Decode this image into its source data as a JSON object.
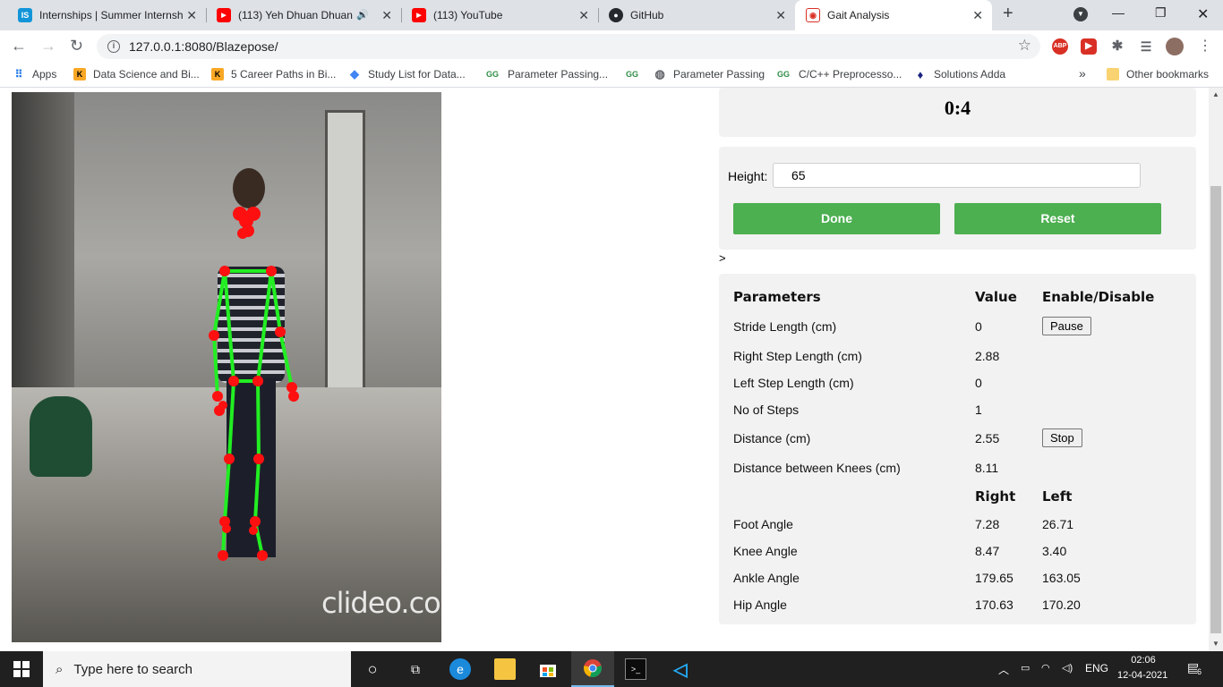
{
  "browser": {
    "tabs": [
      {
        "label": "Internships | Summer Internsh",
        "icon": "internshala-icon",
        "color": "#1295d8",
        "glyph": "IS"
      },
      {
        "label": "(113) Yeh Dhuan Dhuan [",
        "icon": "youtube-icon",
        "color": "#ff0000",
        "glyph": "▶"
      },
      {
        "label": "(113) YouTube",
        "icon": "youtube-icon",
        "color": "#ff0000",
        "glyph": "▶"
      },
      {
        "label": "GitHub",
        "icon": "github-icon",
        "color": "#24292e",
        "glyph": "●"
      },
      {
        "label": "Gait Analysis",
        "icon": "gait-analysis-icon",
        "color": "#d93025",
        "glyph": "◉"
      }
    ],
    "url": "127.0.0.1:8080/Blazepose/",
    "bookmarks": [
      {
        "label": "Apps",
        "icon": "apps-grid-icon"
      },
      {
        "label": "Data Science and Bi...",
        "icon": "k-icon"
      },
      {
        "label": "5 Career Paths in Bi...",
        "icon": "k-icon"
      },
      {
        "label": "Study List for Data...",
        "icon": "diamond-icon"
      },
      {
        "label": "Parameter Passing...",
        "icon": "geeksforgeeks-icon"
      },
      {
        "label": "",
        "icon": "geeksforgeeks-icon"
      },
      {
        "label": "Parameter Passing",
        "icon": "globe-icon"
      },
      {
        "label": "C/C++ Preprocesso...",
        "icon": "geeksforgeeks-icon"
      },
      {
        "label": "Solutions Adda",
        "icon": "solutions-adda-icon"
      }
    ],
    "more_bookmarks": "»",
    "other_bookmarks": "Other bookmarks"
  },
  "page": {
    "timer": "0:4",
    "height_label": "Height:",
    "height_value": "65",
    "done_label": "Done",
    "reset_label": "Reset",
    "gt_text": ">",
    "watermark": "clideo.com",
    "params": {
      "headers": {
        "param": "Parameters",
        "value": "Value",
        "toggle": "Enable/Disable"
      },
      "rows": [
        {
          "label": "Stride Length (cm)",
          "value": "0"
        },
        {
          "label": "Right Step Length (cm)",
          "value": "2.88"
        },
        {
          "label": "Left Step Length (cm)",
          "value": "0"
        },
        {
          "label": "No of Steps",
          "value": "1"
        },
        {
          "label": "Distance (cm)",
          "value": "2.55"
        },
        {
          "label": "Distance between Knees (cm)",
          "value": "8.11"
        }
      ],
      "pause_label": "Pause",
      "stop_label": "Stop",
      "side_headers": {
        "right": "Right",
        "left": "Left"
      },
      "angles": [
        {
          "label": "Foot Angle",
          "right": "7.28",
          "left": "26.71"
        },
        {
          "label": "Knee Angle",
          "right": "8.47",
          "left": "3.40"
        },
        {
          "label": "Ankle Angle",
          "right": "179.65",
          "left": "163.05"
        },
        {
          "label": "Hip Angle",
          "right": "170.63",
          "left": "170.20"
        }
      ]
    }
  },
  "taskbar": {
    "search_placeholder": "Type here to search",
    "language": "ENG",
    "time": "02:06",
    "date": "12-04-2021",
    "notifications": "6"
  }
}
